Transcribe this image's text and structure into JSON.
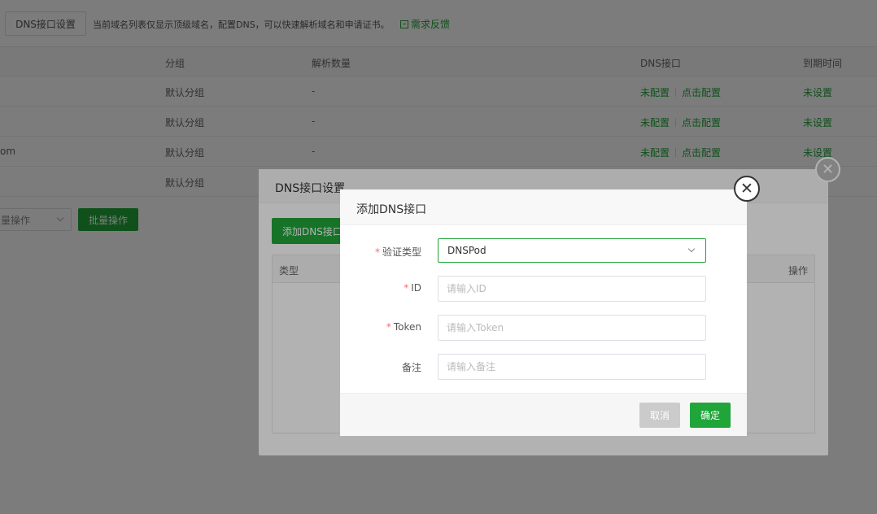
{
  "topbar": {
    "dns_settings_button": "DNS接口设置",
    "tip": "当前域名列表仅显示顶级域名，配置DNS，可以快速解析域名和申请证书。",
    "feedback": "需求反馈"
  },
  "table": {
    "headers": {
      "group": "分组",
      "count": "解析数量",
      "dns": "DNS接口",
      "expire": "到期时间"
    },
    "rows": [
      {
        "name": "",
        "group": "默认分组",
        "count": "-",
        "dns_status": "未配置",
        "dns_action": "点击配置",
        "expire": "未设置"
      },
      {
        "name": "",
        "group": "默认分组",
        "count": "-",
        "dns_status": "未配置",
        "dns_action": "点击配置",
        "expire": "未设置"
      },
      {
        "name": "om",
        "group": "默认分组",
        "count": "-",
        "dns_status": "未配置",
        "dns_action": "点击配置",
        "expire": "未设置"
      },
      {
        "name": "",
        "group": "默认分组",
        "count": "",
        "dns_status": "",
        "dns_action": "",
        "expire": ""
      }
    ]
  },
  "bulk": {
    "select_value": "量操作",
    "button": "批量操作"
  },
  "modal1": {
    "title": "DNS接口设置",
    "add_button": "添加DNS接口",
    "table_head": {
      "type": "类型",
      "actions": "操作"
    }
  },
  "modal2": {
    "title": "添加DNS接口",
    "fields": {
      "type": {
        "label": "验证类型",
        "value": "DNSPod",
        "required": "*"
      },
      "id": {
        "label": "ID",
        "placeholder": "请输入ID",
        "required": "*"
      },
      "token": {
        "label": "Token",
        "placeholder": "请输入Token",
        "required": "*"
      },
      "remark": {
        "label": "备注",
        "placeholder": "请输入备注"
      }
    },
    "cancel": "取消",
    "confirm": "确定"
  },
  "colors": {
    "accent": "#20a53a",
    "required": "#f56c6c",
    "cancel": "#cbcbcb"
  },
  "icons": {
    "close": "close-icon",
    "chevron": "chevron-down-icon",
    "feedback": "feedback-icon"
  }
}
